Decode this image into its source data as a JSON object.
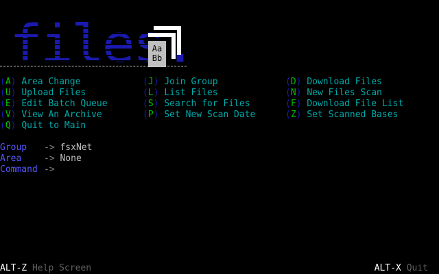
{
  "logo": {
    "text": "files.",
    "badge_line1": "Aa",
    "badge_line2": "Bb"
  },
  "colors": {
    "paren": "#1a1ab0",
    "key": "#00c000",
    "label": "#00aaaa",
    "prompt_label": "#5555ff",
    "value": "#c0c0c0"
  },
  "menu": {
    "col1": [
      {
        "key": "A",
        "label": "Area Change"
      },
      {
        "key": "U",
        "label": "Upload Files"
      },
      {
        "key": "E",
        "label": "Edit Batch Queue"
      },
      {
        "key": "V",
        "label": "View An Archive"
      },
      {
        "key": "Q",
        "label": "Quit to Main"
      }
    ],
    "col2": [
      {
        "key": "J",
        "label": "Join Group"
      },
      {
        "key": "L",
        "label": "List Files"
      },
      {
        "key": "S",
        "label": "Search for Files"
      },
      {
        "key": "P",
        "label": "Set New Scan Date"
      }
    ],
    "col3": [
      {
        "key": "D",
        "label": "Download Files"
      },
      {
        "key": "N",
        "label": "New Files Scan"
      },
      {
        "key": "F",
        "label": "Download File List"
      },
      {
        "key": "Z",
        "label": "Set Scanned Bases"
      }
    ]
  },
  "status": {
    "group_label": "Group",
    "group_arrow": "->",
    "group_value": "fsxNet",
    "area_label": "Area",
    "area_arrow": "->",
    "area_value": "None",
    "command_label": "Command",
    "command_arrow": "->"
  },
  "footer": {
    "left_key": "ALT-Z",
    "left_desc": "Help Screen",
    "right_key": "ALT-X",
    "right_desc": "Quit"
  }
}
